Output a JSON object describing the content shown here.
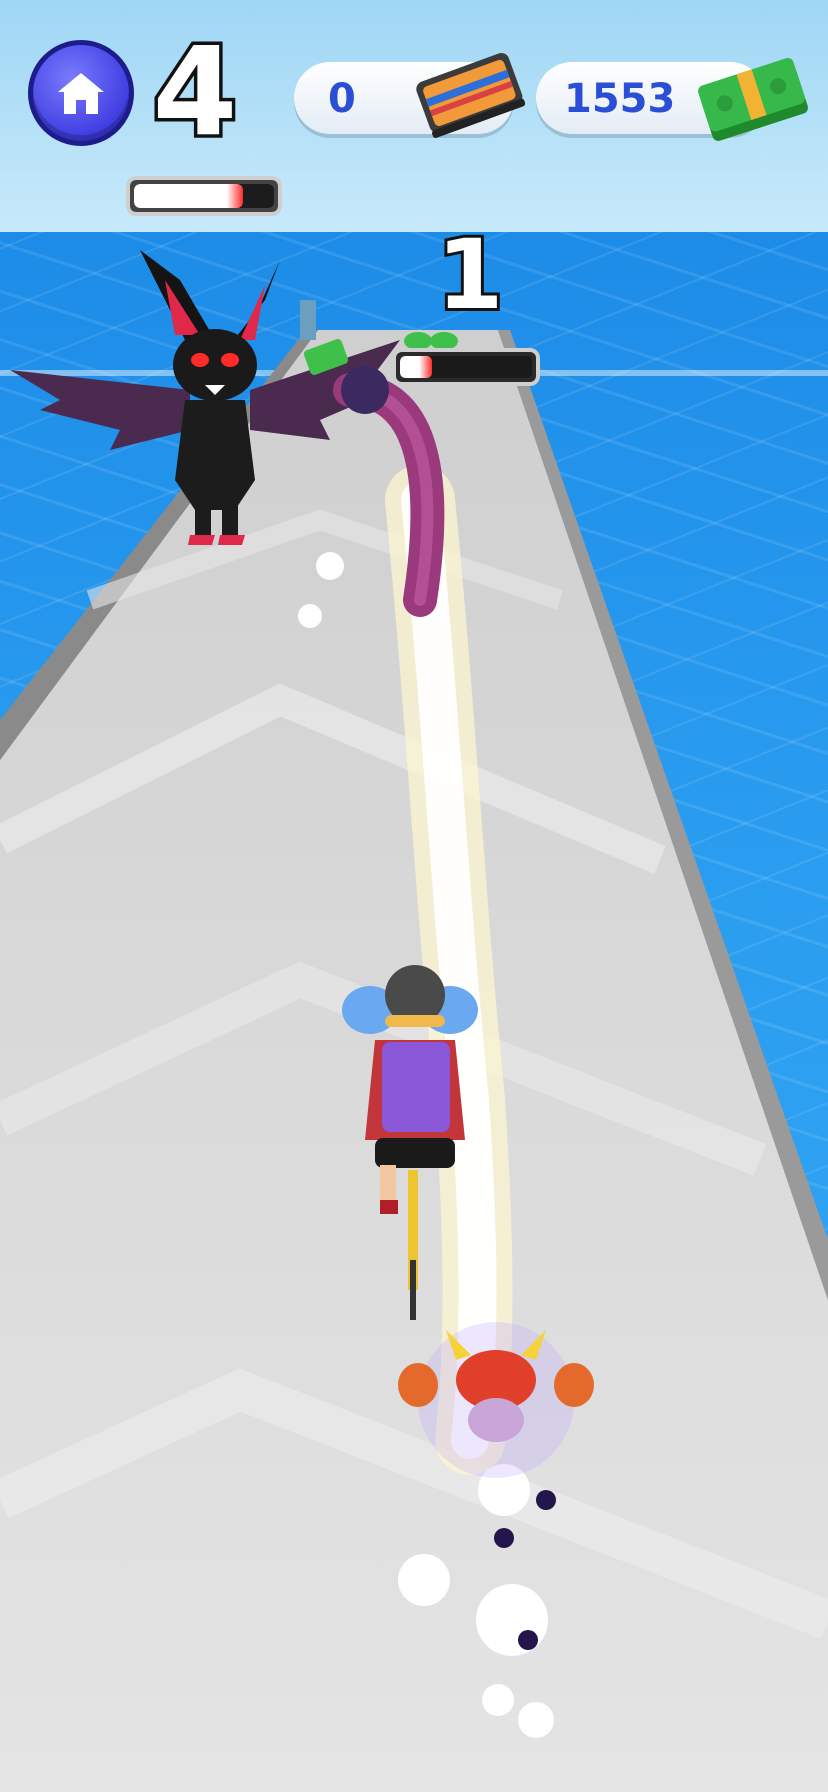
{
  "hud": {
    "level": "4",
    "level_progress": 0.78,
    "tickets": "0",
    "cash": "1553",
    "home_icon": "home-icon",
    "ticket_icon": "cassette-ticket-icon",
    "cash_icon": "money-stack-icon"
  },
  "enemy": {
    "count": "1",
    "health_fraction": 0.24
  },
  "colors": {
    "ocean": "#2a9df0",
    "road": "#dcdcdc",
    "hud_text": "#2a4fd6",
    "health_red": "#ff2b2b",
    "home_button": "#3f3de0"
  }
}
